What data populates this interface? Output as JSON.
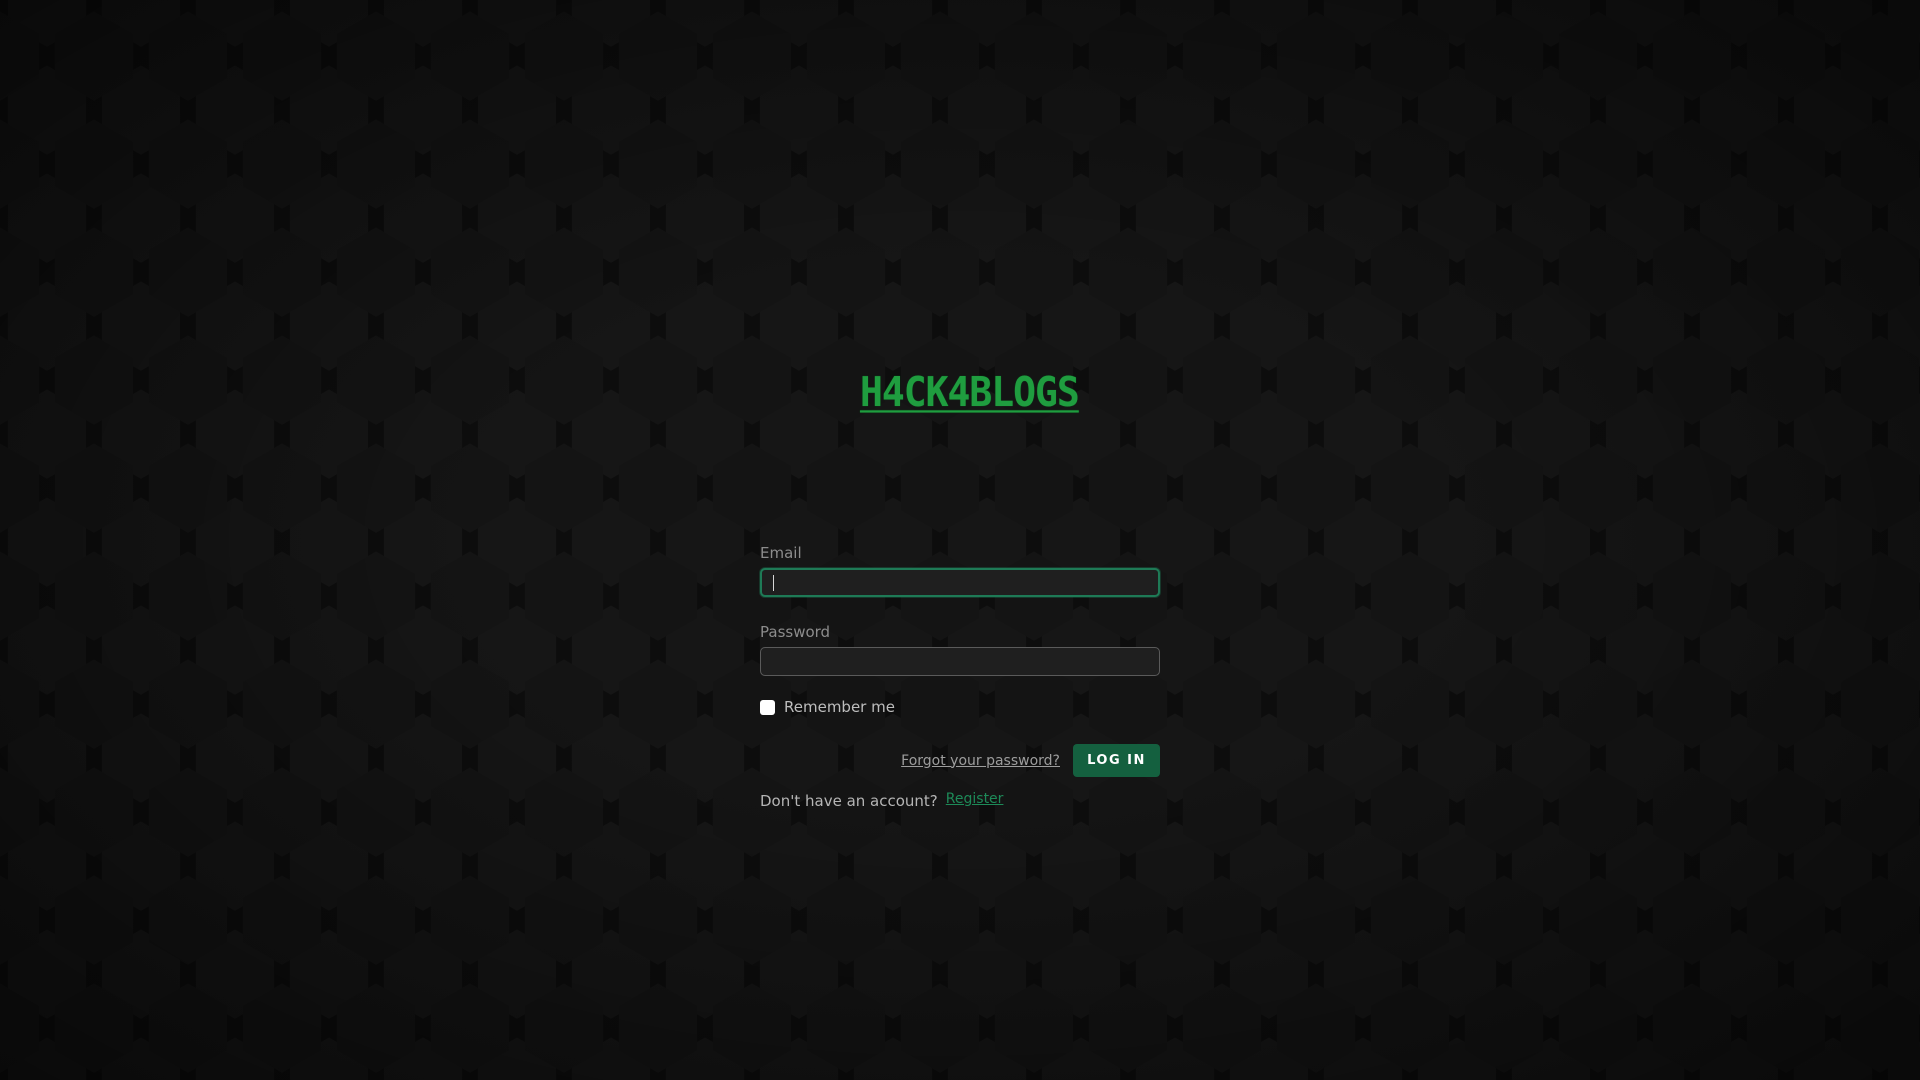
{
  "brand": {
    "logo_text": "H4CK4BLOGS",
    "logo_color": "#1f9d3f"
  },
  "login_form": {
    "email_label": "Email",
    "email_value": "",
    "password_label": "Password",
    "password_value": "",
    "remember_label": "Remember me",
    "remember_checked": false,
    "forgot_link": "Forgot your password?",
    "submit_label": "LOG IN",
    "no_account_text": "Don't have an account?",
    "register_link": "Register"
  },
  "colors": {
    "background": "#0e0e0e",
    "hexagon": "#151515",
    "accent": "#1e7a56",
    "button": "#14603f"
  },
  "icons": {
    "checkbox": "checkbox-unchecked-icon"
  }
}
